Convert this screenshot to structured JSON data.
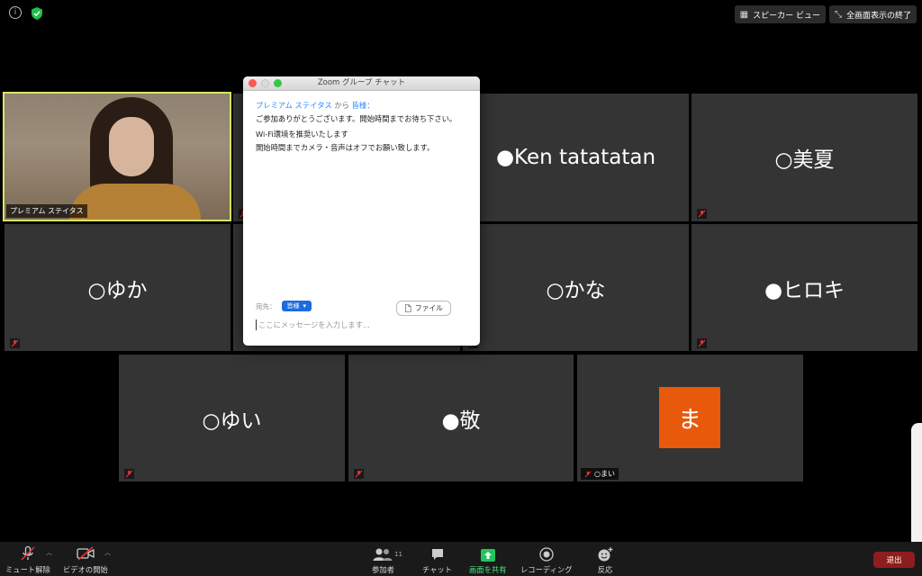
{
  "top_bar": {
    "info_glyph": "i",
    "speaker_view": "スピーカー ビュー",
    "exit_fullscreen": "全画面表示の終了"
  },
  "video_tile": {
    "label": "プレミアム ステイタス"
  },
  "participants": [
    {
      "name": "●Ken tatatatan"
    },
    {
      "name": "○美夏"
    },
    {
      "name": "○ゆか"
    },
    {
      "name": "○かな"
    },
    {
      "name": "●ヒロキ"
    },
    {
      "name": "○ゆい"
    },
    {
      "name": "●敬"
    },
    {
      "avatar_letter": "ま",
      "chip": "○まい",
      "avatar_color": "#e8590c"
    }
  ],
  "chat": {
    "title": "Zoom グループ チャット",
    "sender": "プレミアム ステイタス",
    "from_word": "から",
    "recipient": "皆様：",
    "messages": [
      "ご参加ありがとうございます。開始時間までお待ち下さい。",
      "Wi-Fi環境を推奨いたします",
      "開始時間までカメラ・音声はオフでお願い致します。"
    ],
    "to_label": "宛先：",
    "to_value": "皆様",
    "file_button": "ファイル",
    "input_placeholder": "ここにメッセージを入力します..."
  },
  "toolbar": {
    "unmute": "ミュート解除",
    "start_video": "ビデオの開始",
    "participants": "参加者",
    "participants_count": "11",
    "chat": "チャット",
    "share": "画面を共有",
    "recording": "レコーディング",
    "reactions": "反応",
    "leave": "退出"
  },
  "colors": {
    "accent_blue": "#2d8cff",
    "active_speaker_border": "#d8e66a",
    "share_green": "#21c55d",
    "leave_red": "#8e1d1d"
  }
}
